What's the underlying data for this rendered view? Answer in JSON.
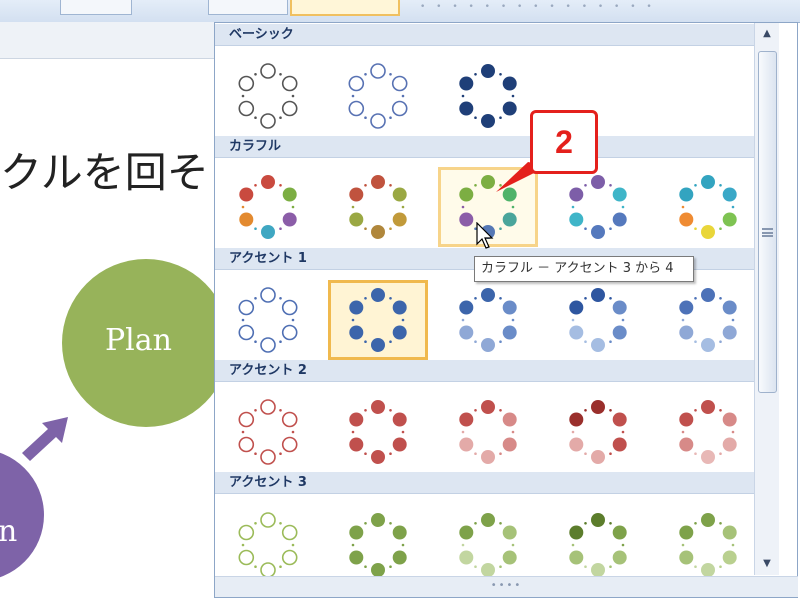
{
  "slide": {
    "title_fragment": "クルを回そ",
    "plan_label": "Plan",
    "do_label_fragment": "n"
  },
  "gallery": {
    "sections": [
      {
        "label": "ベーシック"
      },
      {
        "label": "カラフル"
      },
      {
        "label": "アクセント 1"
      },
      {
        "label": "アクセント 2"
      },
      {
        "label": "アクセント 3"
      }
    ],
    "tooltip": "カラフル － アクセント 3 から 4",
    "selected": "アクセント 1 - 2",
    "hovered": "カラフル - 3"
  },
  "callout": {
    "label": "2",
    "color": "#e4201c"
  },
  "colors": {
    "plan_green": "#97b35a",
    "do_purple": "#7e63a8",
    "header_text": "#1f3864",
    "selection_border": "#f0b94e"
  }
}
